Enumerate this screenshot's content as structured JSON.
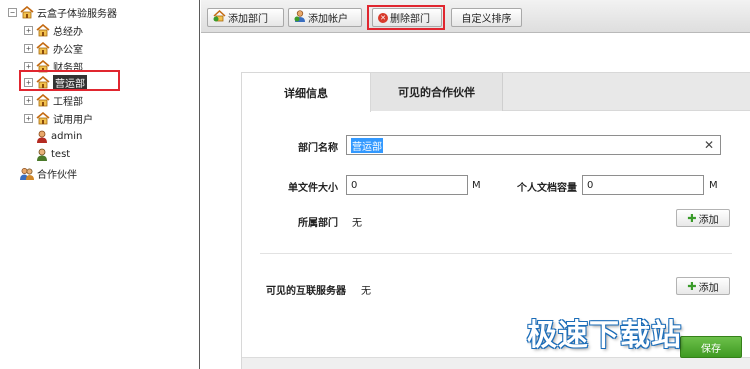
{
  "tree": {
    "root": {
      "label": "云盒子体验服务器",
      "expander": "⊟"
    },
    "items": [
      {
        "label": "总经办",
        "expander": "⊞",
        "icon": "house-icon"
      },
      {
        "label": "办公室",
        "expander": "⊞",
        "icon": "house-icon"
      },
      {
        "label": "财务部",
        "expander": "⊞",
        "icon": "house-icon"
      },
      {
        "label": "营运部",
        "expander": "⊞",
        "icon": "house-icon",
        "selected": true
      },
      {
        "label": "工程部",
        "expander": "⊞",
        "icon": "house-icon"
      },
      {
        "label": "试用用户",
        "expander": "⊞",
        "icon": "house-icon"
      },
      {
        "label": "admin",
        "icon": "user-icon"
      },
      {
        "label": "test",
        "icon": "user-icon"
      }
    ],
    "partners": {
      "label": "合作伙伴",
      "icon": "partners-icon"
    }
  },
  "toolbar": {
    "add_dept": "添加部门",
    "add_account": "添加帐户",
    "delete_dept": "删除部门",
    "custom_sort": "自定义排序"
  },
  "tabs": {
    "details": "详细信息",
    "visible_partners": "可见的合作伙伴"
  },
  "form": {
    "dept_name_label": "部门名称",
    "dept_name_value": "营运部",
    "file_size_label": "单文件大小",
    "file_size_value": "0",
    "file_size_unit": "M",
    "personal_quota_label": "个人文档容量",
    "personal_quota_value": "0",
    "personal_quota_unit": "M",
    "parent_dept_label": "所属部门",
    "parent_dept_value": "无",
    "add_label": "添加",
    "visible_servers_label": "可见的互联服务器",
    "visible_servers_value": "无",
    "save_label": "保存"
  },
  "watermark": "极速下载站",
  "colors": {
    "highlight_red": "#e0262f",
    "save_green": "#4aa62a",
    "selection_blue": "#3399ff"
  }
}
